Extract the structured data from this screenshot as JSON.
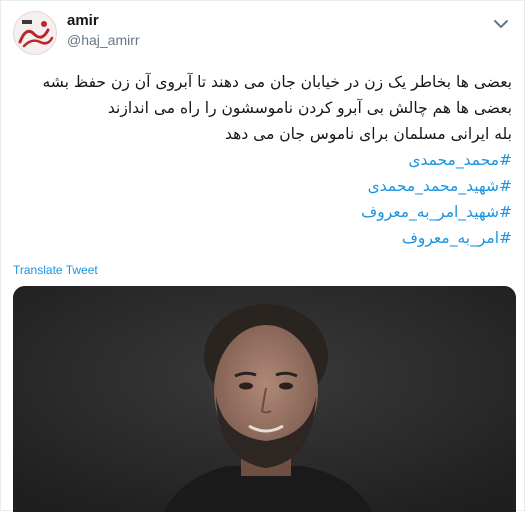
{
  "user": {
    "name": "amir",
    "handle": "@haj_amirr",
    "avatar_icon": "profile-avatar-calligraphy"
  },
  "menu": {
    "icon": "chevron-down-icon"
  },
  "tweet": {
    "lines": [
      "بعضی ها بخاطر یک زن در خیابان جان می دهند تا آبروی آن زن حفظ بشه",
      "بعضی ها هم چالش بی آبرو کردن ناموسشون را راه می اندازند",
      "بله ایرانی مسلمان برای ناموس جان می دهد"
    ],
    "hashtags": [
      "#محمد_محمدی",
      "#شهید_محمد_محمدی",
      "#شهید_امر_به_معروف",
      "#امر_به_معروف"
    ]
  },
  "translate_label": "Translate Tweet",
  "media": {
    "icon": "portrait-photo",
    "background_color": "#2b2b2b"
  },
  "colors": {
    "link": "#1b95e0",
    "text": "#14171a",
    "secondary": "#657786"
  }
}
